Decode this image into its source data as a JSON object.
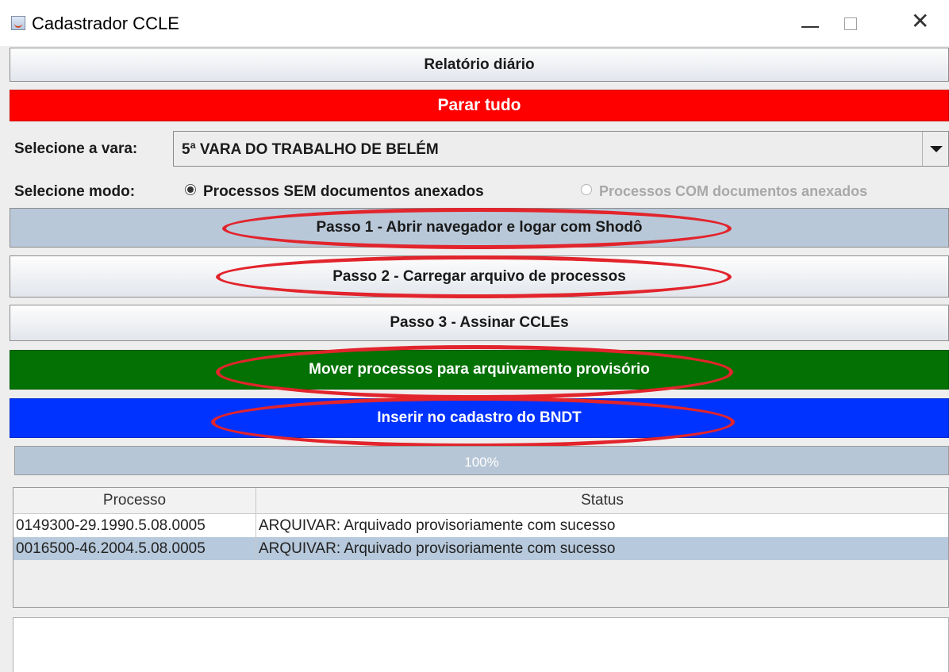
{
  "window": {
    "title": "Cadastrador CCLE"
  },
  "buttons": {
    "relatorio": "Relatório diário",
    "parar": "Parar tudo",
    "passo1": "Passo 1 - Abrir navegador e logar com Shodô",
    "passo2": "Passo 2 - Carregar arquivo de processos",
    "passo3": "Passo 3 - Assinar CCLEs",
    "mover": "Mover processos para arquivamento provisório",
    "inserir": "Inserir no cadastro do BNDT"
  },
  "vara": {
    "label": "Selecione a vara:",
    "selected": "5ª VARA DO TRABALHO DE BELÉM"
  },
  "modo": {
    "label": "Selecione modo:",
    "option_sem": "Processos SEM documentos anexados",
    "option_com": "Processos COM documentos anexados",
    "selected": "sem"
  },
  "progress": {
    "text": "100%",
    "value": 1.0
  },
  "table": {
    "headers": [
      "Processo",
      "Status"
    ],
    "rows": [
      [
        "0149300-29.1990.5.08.0005",
        "ARQUIVAR: Arquivado provisoriamente com sucesso"
      ],
      [
        "0016500-46.2004.5.08.0005",
        "ARQUIVAR: Arquivado provisoriamente com sucesso"
      ]
    ]
  },
  "colors": {
    "parar_bg": "#ff0000",
    "mover_bg": "#037103",
    "inserir_bg": "#0033ff",
    "selected_row": "#b7c9dc",
    "annotation_ring": "#e2242c"
  },
  "icons": {
    "app": "java-cup-icon",
    "minimize": "minimize-icon",
    "maximize": "maximize-icon",
    "close": "close-icon"
  }
}
